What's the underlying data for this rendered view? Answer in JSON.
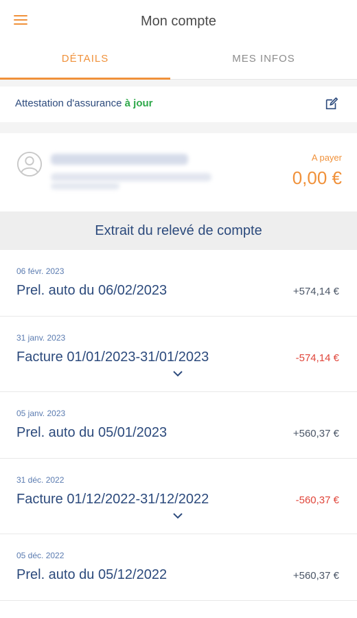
{
  "header": {
    "title": "Mon compte"
  },
  "tabs": [
    {
      "label": "DÉTAILS"
    },
    {
      "label": "MES INFOS"
    }
  ],
  "attestation": {
    "text": "Attestation d'assurance",
    "status": "à jour"
  },
  "account": {
    "pay_label": "A payer",
    "pay_amount": "0,00 €"
  },
  "statement": {
    "title": "Extrait du relevé de compte",
    "entries": [
      {
        "date": "06 févr. 2023",
        "label": "Prel. auto du 06/02/2023",
        "amount": "+574,14 €"
      },
      {
        "date": "31 janv. 2023",
        "label": "Facture 01/01/2023-31/01/2023",
        "amount": "-574,14 €"
      },
      {
        "date": "05 janv. 2023",
        "label": "Prel. auto du 05/01/2023",
        "amount": "+560,37 €"
      },
      {
        "date": "31 déc. 2022",
        "label": "Facture 01/12/2022-31/12/2022",
        "amount": "-560,37 €"
      },
      {
        "date": "05 déc. 2022",
        "label": "Prel. auto du 05/12/2022",
        "amount": "+560,37 €"
      }
    ]
  },
  "colors": {
    "accent": "#f0913a",
    "primary": "#2c4a7c",
    "positive_status": "#2ea84a",
    "negative": "#e0453a"
  }
}
